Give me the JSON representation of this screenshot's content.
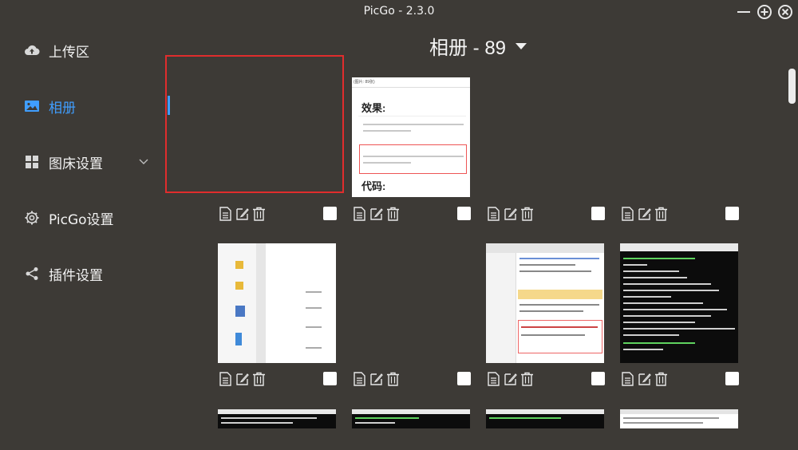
{
  "window": {
    "title": "PicGo - 2.3.0",
    "minimize_icon": "minus-icon",
    "maximize_icon": "plus-circle-icon",
    "close_icon": "close-circle-icon"
  },
  "sidebar": {
    "items": [
      {
        "label": "上传区",
        "icon": "cloud-upload-icon",
        "active": false
      },
      {
        "label": "相册",
        "icon": "image-icon",
        "active": true
      },
      {
        "label": "图床设置",
        "icon": "grid-icon",
        "active": false,
        "expandable": true
      },
      {
        "label": "PicGo设置",
        "icon": "gear-icon",
        "active": false
      },
      {
        "label": "插件设置",
        "icon": "share-icon",
        "active": false
      }
    ],
    "info_icon": "info-icon"
  },
  "gallery": {
    "header": "相册 - 89",
    "accent_color": "#409eff",
    "highlight_color": "#e02d2d",
    "thumb1_title": "效果:",
    "thumb1_footer": "代码:",
    "thumb1_label": "(图片: 89张)",
    "rows": [
      [
        "empty",
        "doc",
        "blank",
        "blank"
      ],
      [
        "explorer",
        "blank",
        "editor",
        "terminal"
      ],
      [
        "terminal",
        "terminal",
        "terminal",
        "editor"
      ]
    ],
    "action_icons": [
      "copy-icon",
      "edit-icon",
      "delete-icon",
      "checkbox"
    ]
  }
}
